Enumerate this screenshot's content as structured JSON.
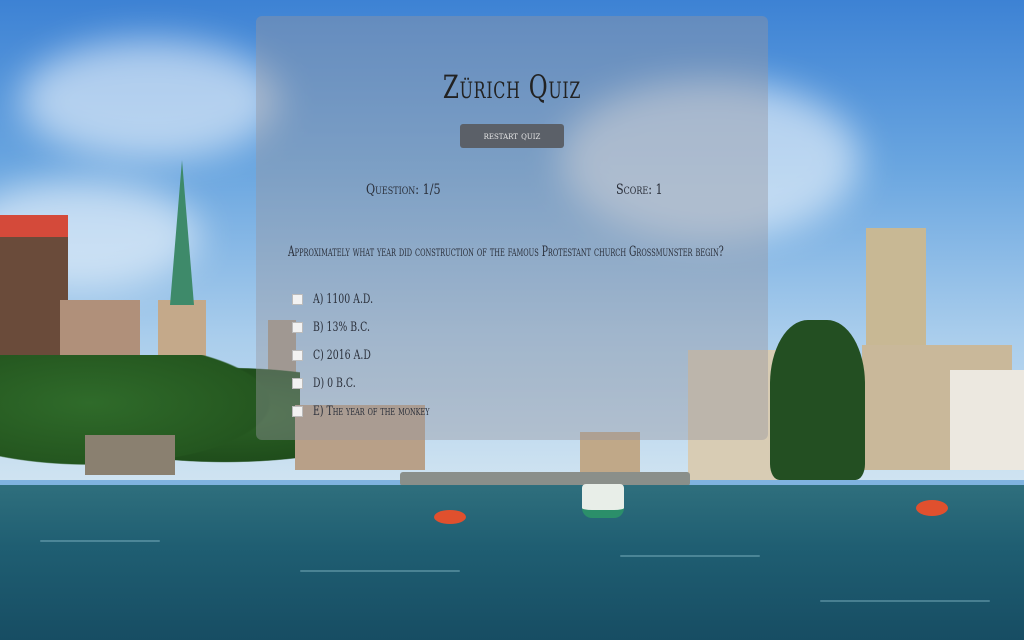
{
  "quiz": {
    "title": "Zürich Quiz",
    "restart_label": "restart quiz",
    "question_counter": "Question: 1/5",
    "score": "Score: 1",
    "question": "Approximately what year did construction of the famous Protestant church Grossmunster begin?",
    "options": [
      "A) 1100 A.D.",
      "B) 13% B.C.",
      "C) 2016 A.D",
      "D) 0 B.C.",
      "E) The year of the monkey"
    ]
  },
  "colors": {
    "panel": "#969aa0",
    "button": "#5b6068",
    "text": "#2a2f3a"
  }
}
